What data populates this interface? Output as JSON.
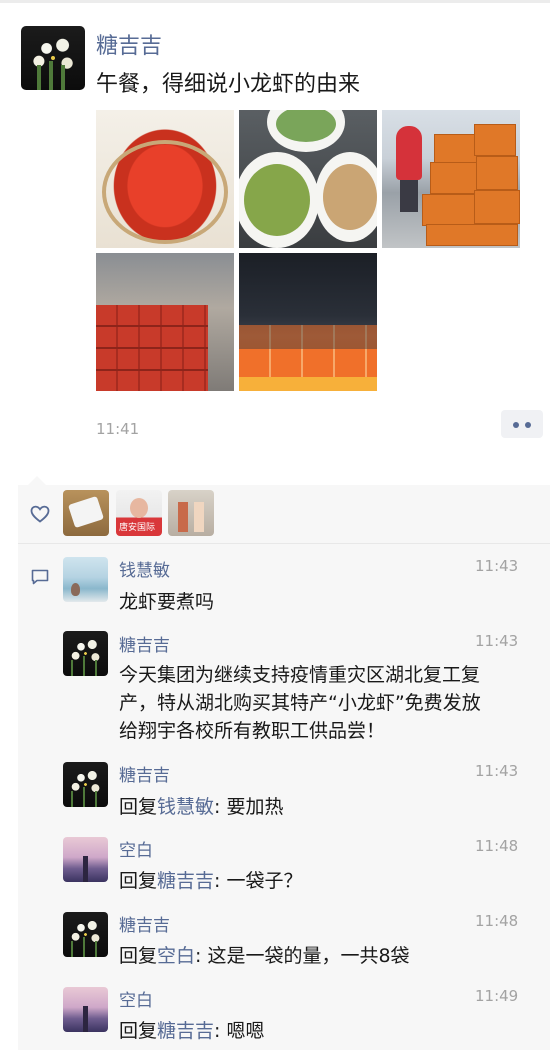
{
  "post": {
    "author": "糖吉吉",
    "text": "午餐，得细说小龙虾的由来",
    "time": "11:41",
    "photos": [
      "crayfish",
      "vegetable-dishes",
      "cart-with-boxes",
      "boxes-in-hall",
      "boxes-in-dark-room"
    ]
  },
  "comments": [
    {
      "name": "钱慧敏",
      "time": "11:43",
      "text": "龙虾要煮吗",
      "avatar": "pool"
    },
    {
      "name": "糖吉吉",
      "time": "11:43",
      "lines": [
        "今天集团为继续支持疫情重灾区湖北复工复",
        "产，特从湖北购买其特产“小龙虾”免费发放",
        "给翔宇各校所有教职工供品尝！"
      ],
      "avatar": "narcissus"
    },
    {
      "name": "糖吉吉",
      "time": "11:43",
      "reply_prefix": "回复",
      "reply_to": "钱慧敏",
      "reply_text": ": 要加热",
      "avatar": "narcissus"
    },
    {
      "name": "空白",
      "time": "11:48",
      "reply_prefix": "回复",
      "reply_to": "糖吉吉",
      "reply_text": ": 一袋子？",
      "avatar": "pier"
    },
    {
      "name": "糖吉吉",
      "time": "11:48",
      "reply_prefix": "回复",
      "reply_to": "空白",
      "reply_text": ": 这是一袋的量，一共8袋",
      "avatar": "narcissus"
    },
    {
      "name": "空白",
      "time": "11:49",
      "reply_prefix": "回复",
      "reply_to": "糖吉吉",
      "reply_text": ": 嗯嗯",
      "avatar": "pier"
    }
  ],
  "likes": {
    "avatars": [
      "phone",
      "baby",
      "kids"
    ],
    "baby_caption": "唐安国际"
  },
  "icons": {
    "heart": "heart-icon",
    "comment": "comment-icon",
    "more": "more-icon"
  },
  "colors": {
    "name": "#576b95",
    "text": "#191919",
    "time": "#a3a3a3",
    "panel": "#f7f7f7"
  }
}
